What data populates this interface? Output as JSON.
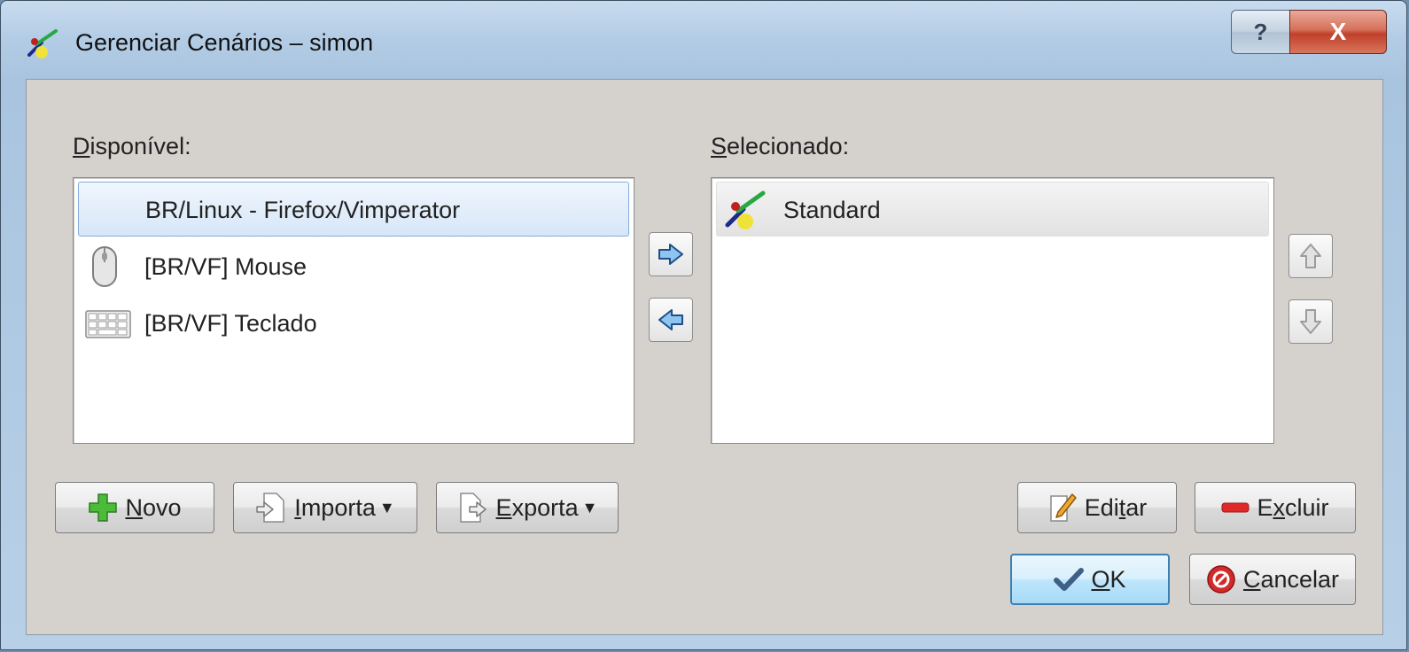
{
  "window": {
    "title": "Gerenciar Cenários – simon",
    "help_label": "?",
    "close_label": "X"
  },
  "available": {
    "label_mnemonic": "D",
    "label_rest": "isponível:",
    "items": [
      {
        "label": "BR/Linux - Firefox/Vimperator",
        "icon": "none",
        "selected": true
      },
      {
        "label": "[BR/VF] Mouse",
        "icon": "mouse-icon",
        "selected": false
      },
      {
        "label": "[BR/VF] Teclado",
        "icon": "keyboard-icon",
        "selected": false
      }
    ]
  },
  "selected": {
    "label_mnemonic": "S",
    "label_rest": "elecionado:",
    "items": [
      {
        "label": "Standard",
        "icon": "simon-logo-icon",
        "selected": true
      }
    ]
  },
  "buttons": {
    "novo": {
      "mn": "N",
      "rest": "ovo"
    },
    "importar": {
      "mn": "I",
      "rest": "mporta"
    },
    "exportar": {
      "mn": "E",
      "rest": "xporta"
    },
    "editar": {
      "pre": "Edi",
      "mn": "t",
      "rest": "ar"
    },
    "excluir": {
      "pre": "E",
      "mn": "x",
      "rest": "cluir"
    },
    "ok": {
      "mn": "O",
      "rest": "K"
    },
    "cancelar": {
      "mn": "C",
      "rest": "ancelar"
    }
  },
  "colors": {
    "dialog_bg": "#d5d2ce",
    "selection_blue": "#d6e6f8",
    "close_red": "#c0402a",
    "default_button": "#bee6fd"
  }
}
